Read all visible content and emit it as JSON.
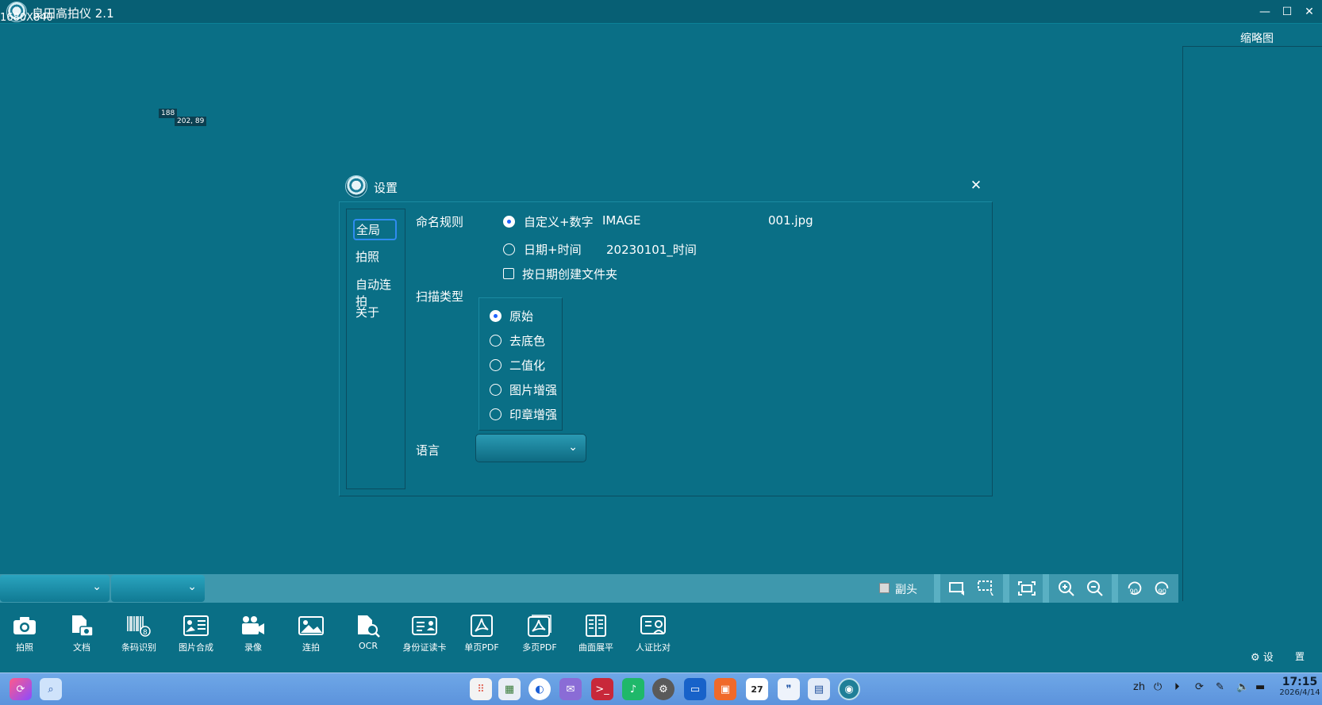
{
  "window": {
    "title": "良田高拍仪 2.1",
    "resolution": "1680X840",
    "minimize": "—",
    "maximize": "☐",
    "close": "✕"
  },
  "overlay": {
    "coord_a": "188",
    "coord_b": "202, 89"
  },
  "thumbnail": {
    "title": "缩略图"
  },
  "dialog": {
    "title": "设置",
    "close": "✕",
    "nav": [
      {
        "label": "全局",
        "active": true
      },
      {
        "label": "拍照",
        "active": false
      },
      {
        "label": "自动连拍",
        "active": false
      },
      {
        "label": "关于",
        "active": false
      }
    ],
    "naming": {
      "label": "命名规则",
      "custom_label": "自定义+数字",
      "custom_prefix": "IMAGE",
      "custom_suffix": "001.jpg",
      "datetime_label": "日期+时间",
      "datetime_value": "20230101_时间",
      "folder_by_date": "按日期创建文件夹",
      "selected": "custom"
    },
    "scan": {
      "label": "扫描类型",
      "options": [
        "原始",
        "去底色",
        "二值化",
        "图片增强",
        "印章增强"
      ],
      "selected": 0
    },
    "language": {
      "label": "语言",
      "value": ""
    }
  },
  "strip": {
    "dropdown1": "",
    "dropdown2": "",
    "sub_camera_label": "副头"
  },
  "functions": [
    {
      "label": "拍照",
      "icon": "camera-icon"
    },
    {
      "label": "文档",
      "icon": "document-camera-icon"
    },
    {
      "label": "条码识别",
      "icon": "barcode-icon"
    },
    {
      "label": "图片合成",
      "icon": "image-merge-icon"
    },
    {
      "label": "录像",
      "icon": "video-icon"
    },
    {
      "label": "连拍",
      "icon": "burst-icon"
    },
    {
      "label": "OCR",
      "icon": "ocr-icon"
    },
    {
      "label": "身份证读卡",
      "icon": "id-card-icon"
    },
    {
      "label": "单页PDF",
      "icon": "pdf-icon"
    },
    {
      "label": "多页PDF",
      "icon": "multi-pdf-icon"
    },
    {
      "label": "曲面展平",
      "icon": "book-flatten-icon"
    },
    {
      "label": "人证比对",
      "icon": "face-compare-icon"
    }
  ],
  "settings": {
    "label_a": "设",
    "label_b": "置"
  },
  "taskbar": {
    "lang": "zh",
    "time": "17:15",
    "date": "2026/4/14",
    "calendar_day": "27"
  }
}
